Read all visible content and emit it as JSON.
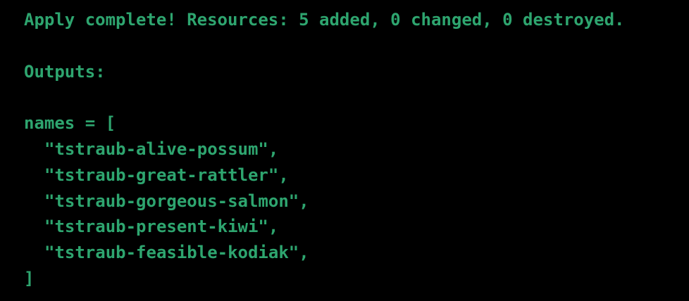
{
  "theme": {
    "background": "#000000",
    "text_color": "#2ea56f"
  },
  "terminal": {
    "apply_message": "Apply complete! Resources: 5 added, 0 changed, 0 destroyed.",
    "outputs_header": "Outputs:",
    "names_open": "names = [",
    "names": [
      "\"tstraub-alive-possum\",",
      "\"tstraub-great-rattler\",",
      "\"tstraub-gorgeous-salmon\",",
      "\"tstraub-present-kiwi\",",
      "\"tstraub-feasible-kodiak\","
    ],
    "names_close": "]"
  }
}
